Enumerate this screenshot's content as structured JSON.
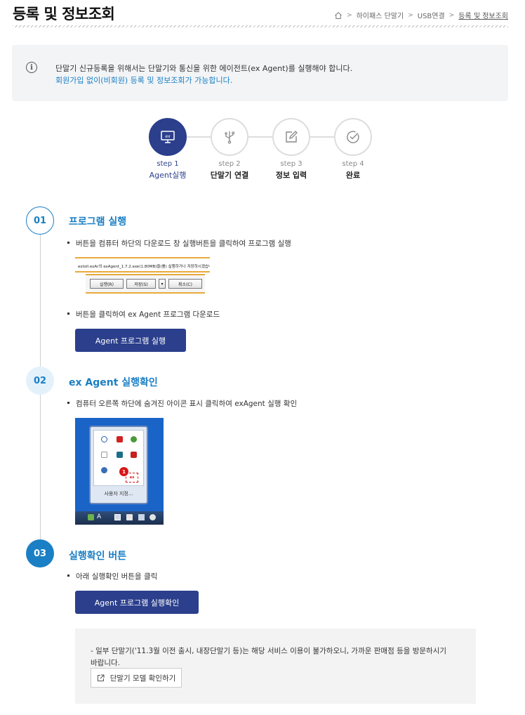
{
  "page": {
    "title": "등록 및 정보조회"
  },
  "breadcrumb": {
    "items": [
      "하이패스 단말기",
      "USB연결",
      "등록 및 정보조회"
    ]
  },
  "notice": {
    "line1": "단말기 신규등록을 위해서는 단말기와 통신을 위한 에이전트(ex Agent)를 실행해야 합니다.",
    "line2": "회원가입 없이(비회원) 등록 및 정보조회가 가능합니다."
  },
  "stepper": {
    "steps": [
      {
        "num": "step 1",
        "name": "Agent실행",
        "icon": "monitor-ex-icon",
        "active": true
      },
      {
        "num": "step 2",
        "name": "단말기 연결",
        "icon": "usb-icon",
        "active": false
      },
      {
        "num": "step 3",
        "name": "정보 입력",
        "icon": "edit-icon",
        "active": false
      },
      {
        "num": "step 4",
        "name": "완료",
        "icon": "check-circle-icon",
        "active": false
      }
    ]
  },
  "sections": [
    {
      "num": "01",
      "title": "프로그램 실행",
      "bullets": [
        "버튼을 컴퓨터 하단의 다운로드 창 실행버튼을 클릭하여 프로그램 실행",
        "버튼을 클릭하여 ex Agent 프로그램 다운로드"
      ],
      "button": "Agent 프로그램 실행"
    },
    {
      "num": "02",
      "title": "ex Agent 실행확인",
      "bullets": [
        "컴퓨터 오른쪽 하단에 숨겨진 아이콘 표시 클릭하여 exAgent 실행 확인"
      ]
    },
    {
      "num": "03",
      "title": "실행확인 버튼",
      "bullets": [
        "아래 실행확인 버튼을 클릭"
      ],
      "button": "Agent 프로그램 실행확인"
    }
  ],
  "download_bar": {
    "message": "extoll.exAr의 exAgent_1.7.2.exe(1.80MB)을(를) 실행하거나 저장하시겠습니까?",
    "run": "실행(R)",
    "save": "저장(S)",
    "cancel": "취소(C)"
  },
  "tray": {
    "badge": "1",
    "highlight": "ex",
    "customize": "사용자 지정..."
  },
  "bottom_notice": {
    "text": "- 일부 단말기('11.3월 이전 출시, 내장단말기 등)는 해당 서비스 이용이 불가하오니, 가까운 판매점 등을 방문하시기 바랍니다.",
    "model_button": "단말기 모델 확인하기"
  },
  "colors": {
    "primary": "#2b3f8c",
    "accent": "#1a7fc4"
  }
}
